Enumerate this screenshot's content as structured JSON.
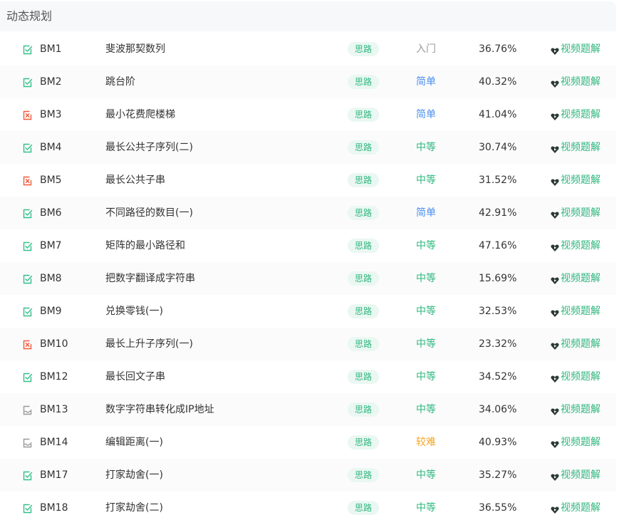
{
  "header": {
    "title": "动态规划"
  },
  "colors": {
    "passed": "#32c08a",
    "failed": "#f05a3a",
    "unattempted": "#999999",
    "diff_entry": "#999999",
    "diff_easy": "#4b8fef",
    "diff_medium": "#2fb77e",
    "diff_hard": "#f5a623"
  },
  "icons": {
    "passed": "checkbox-check-icon",
    "failed": "checkbox-x-icon",
    "unattempted": "tray-icon",
    "video": "heart-play-icon"
  },
  "problems": [
    {
      "id": "BM1",
      "name": "斐波那契数列",
      "tag": "思路",
      "difficulty": "入门",
      "level": "entry",
      "rate": "36.76%",
      "video": "视频题解",
      "status": "passed"
    },
    {
      "id": "BM2",
      "name": "跳台阶",
      "tag": "思路",
      "difficulty": "简单",
      "level": "easy",
      "rate": "40.32%",
      "video": "视频题解",
      "status": "passed"
    },
    {
      "id": "BM3",
      "name": "最小花费爬楼梯",
      "tag": "思路",
      "difficulty": "简单",
      "level": "easy",
      "rate": "41.04%",
      "video": "视频题解",
      "status": "failed"
    },
    {
      "id": "BM4",
      "name": "最长公共子序列(二)",
      "tag": "思路",
      "difficulty": "中等",
      "level": "medium",
      "rate": "30.74%",
      "video": "视频题解",
      "status": "passed"
    },
    {
      "id": "BM5",
      "name": "最长公共子串",
      "tag": "思路",
      "difficulty": "中等",
      "level": "medium",
      "rate": "31.52%",
      "video": "视频题解",
      "status": "failed"
    },
    {
      "id": "BM6",
      "name": "不同路径的数目(一)",
      "tag": "思路",
      "difficulty": "简单",
      "level": "easy",
      "rate": "42.91%",
      "video": "视频题解",
      "status": "passed"
    },
    {
      "id": "BM7",
      "name": "矩阵的最小路径和",
      "tag": "思路",
      "difficulty": "中等",
      "level": "medium",
      "rate": "47.16%",
      "video": "视频题解",
      "status": "passed"
    },
    {
      "id": "BM8",
      "name": "把数字翻译成字符串",
      "tag": "思路",
      "difficulty": "中等",
      "level": "medium",
      "rate": "15.69%",
      "video": "视频题解",
      "status": "passed"
    },
    {
      "id": "BM9",
      "name": "兑换零钱(一)",
      "tag": "思路",
      "difficulty": "中等",
      "level": "medium",
      "rate": "32.53%",
      "video": "视频题解",
      "status": "passed"
    },
    {
      "id": "BM10",
      "name": "最长上升子序列(一)",
      "tag": "思路",
      "difficulty": "中等",
      "level": "medium",
      "rate": "23.32%",
      "video": "视频题解",
      "status": "failed"
    },
    {
      "id": "BM12",
      "name": "最长回文子串",
      "tag": "思路",
      "difficulty": "中等",
      "level": "medium",
      "rate": "34.52%",
      "video": "视频题解",
      "status": "passed"
    },
    {
      "id": "BM13",
      "name": "数字字符串转化成IP地址",
      "tag": "思路",
      "difficulty": "中等",
      "level": "medium",
      "rate": "34.06%",
      "video": "视频题解",
      "status": "unattempted"
    },
    {
      "id": "BM14",
      "name": "编辑距离(一)",
      "tag": "思路",
      "difficulty": "较难",
      "level": "hard",
      "rate": "40.93%",
      "video": "视频题解",
      "status": "unattempted"
    },
    {
      "id": "BM17",
      "name": "打家劫舍(一)",
      "tag": "思路",
      "difficulty": "中等",
      "level": "medium",
      "rate": "35.27%",
      "video": "视频题解",
      "status": "passed"
    },
    {
      "id": "BM18",
      "name": "打家劫舍(二)",
      "tag": "思路",
      "difficulty": "中等",
      "level": "medium",
      "rate": "36.55%",
      "video": "视频题解",
      "status": "passed"
    }
  ]
}
